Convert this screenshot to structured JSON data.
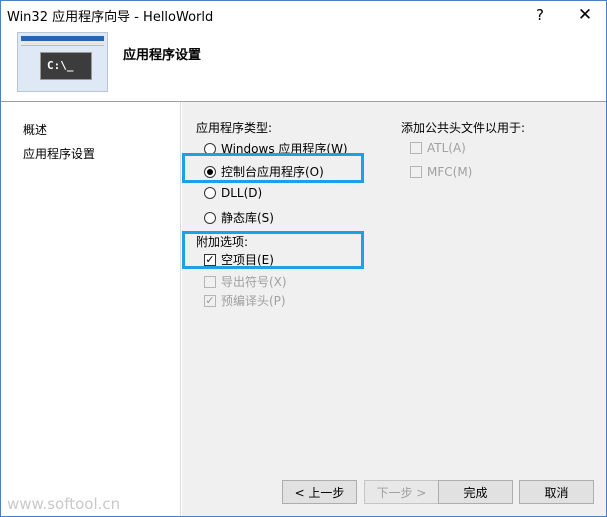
{
  "window": {
    "title": "Win32 应用程序向导 - HelloWorld",
    "help_glyph": "?",
    "close_glyph": "✕"
  },
  "header": {
    "title": "应用程序设置",
    "console_text": "C:\\_"
  },
  "nav": {
    "items": [
      {
        "label": "概述"
      },
      {
        "label": "应用程序设置"
      }
    ]
  },
  "app_type": {
    "label": "应用程序类型:",
    "options": [
      {
        "label": "Windows 应用程序(W)",
        "selected": false
      },
      {
        "label": "控制台应用程序(O)",
        "selected": true
      },
      {
        "label": "DLL(D)",
        "selected": false
      },
      {
        "label": "静态库(S)",
        "selected": false
      }
    ]
  },
  "extra_options": {
    "label": "附加选项:",
    "options": [
      {
        "label": "空项目(E)",
        "checked": true,
        "enabled": true
      },
      {
        "label": "导出符号(X)",
        "checked": false,
        "enabled": false
      },
      {
        "label": "预编译头(P)",
        "checked": true,
        "enabled": false
      }
    ]
  },
  "common_headers": {
    "label": "添加公共头文件以用于:",
    "options": [
      {
        "label": "ATL(A)",
        "checked": false,
        "enabled": false
      },
      {
        "label": "MFC(M)",
        "checked": false,
        "enabled": false
      }
    ]
  },
  "buttons": {
    "prev": "< 上一步",
    "next": "下一步 >",
    "finish": "完成",
    "cancel": "取消"
  },
  "watermark": "www.softool.cn",
  "colors": {
    "highlight": "#1ea0e6",
    "pane_bg": "#f0f0f0"
  }
}
